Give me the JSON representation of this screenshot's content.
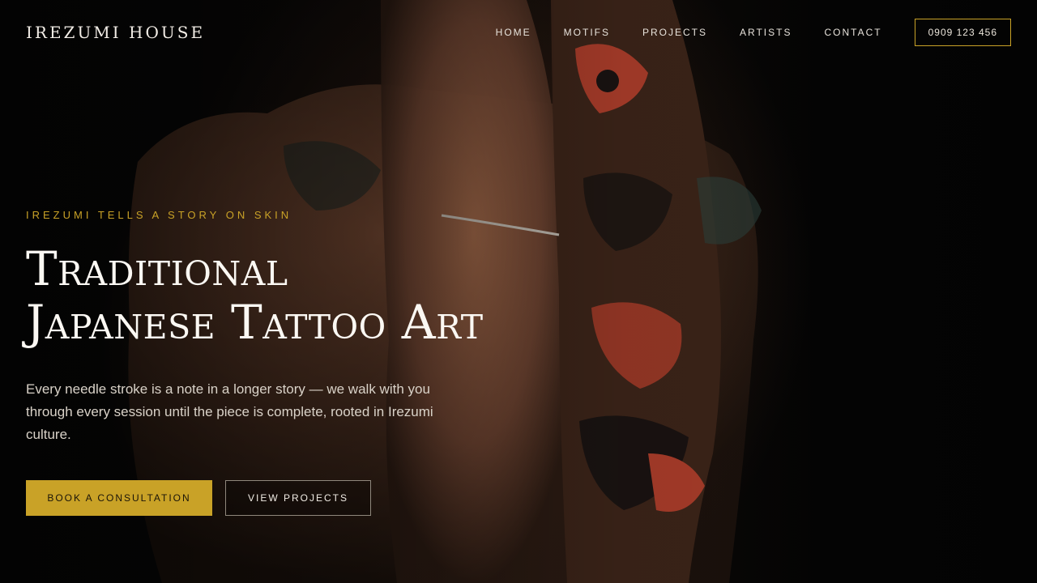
{
  "brand": {
    "name": "IREZUMI HOUSE"
  },
  "nav": {
    "items": [
      {
        "label": "HOME"
      },
      {
        "label": "MOTIFS"
      },
      {
        "label": "PROJECTS"
      },
      {
        "label": "ARTISTS"
      },
      {
        "label": "CONTACT"
      }
    ],
    "phone": "0909 123 456"
  },
  "hero": {
    "eyebrow": "IREZUMI TELLS A STORY ON SKIN",
    "title_line1": "Traditional",
    "title_line2": "Japanese Tattoo Art",
    "description": "Every needle stroke is a note in a longer story — we walk with you through every session until the piece is complete, rooted in Irezumi culture.",
    "primary_cta": "BOOK A CONSULTATION",
    "secondary_cta": "VIEW PROJECTS"
  },
  "colors": {
    "accent": "#c9a227",
    "background": "#050505"
  }
}
